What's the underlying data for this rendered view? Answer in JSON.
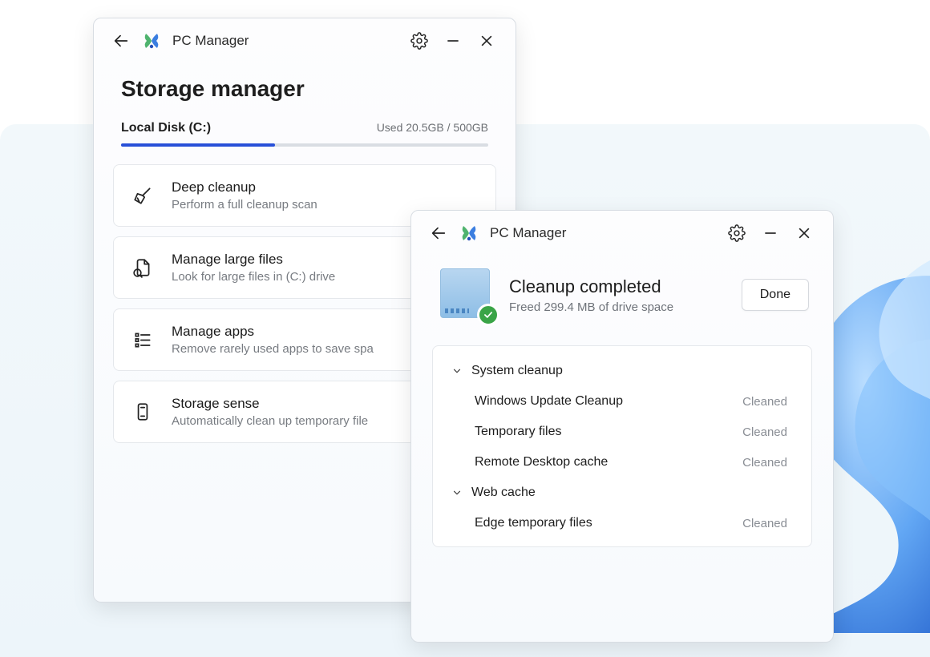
{
  "app": {
    "title": "PC Manager"
  },
  "storage_window": {
    "heading": "Storage manager",
    "disk": {
      "name": "Local Disk (C:)",
      "usage_label": "Used 20.5GB / 500GB",
      "fill_percent": 42
    },
    "options": [
      {
        "icon": "broom",
        "title": "Deep cleanup",
        "subtitle": "Perform a full cleanup scan"
      },
      {
        "icon": "large-files",
        "title": "Manage large files",
        "subtitle": "Look for large files in (C:) drive"
      },
      {
        "icon": "apps-list",
        "title": "Manage apps",
        "subtitle": "Remove rarely used apps to save spa"
      },
      {
        "icon": "storage-sense",
        "title": "Storage sense",
        "subtitle": "Automatically clean up temporary file"
      }
    ]
  },
  "cleanup_window": {
    "result": {
      "title": "Cleanup completed",
      "subtitle": "Freed 299.4 MB of drive space",
      "done_label": "Done"
    },
    "groups": [
      {
        "label": "System cleanup",
        "items": [
          {
            "label": "Windows Update Cleanup",
            "status": "Cleaned"
          },
          {
            "label": "Temporary files",
            "status": "Cleaned"
          },
          {
            "label": "Remote Desktop cache",
            "status": "Cleaned"
          }
        ]
      },
      {
        "label": "Web cache",
        "items": [
          {
            "label": "Edge temporary files",
            "status": "Cleaned"
          }
        ]
      }
    ]
  },
  "colors": {
    "progress": "#2850d8",
    "check_badge": "#3aa447"
  }
}
